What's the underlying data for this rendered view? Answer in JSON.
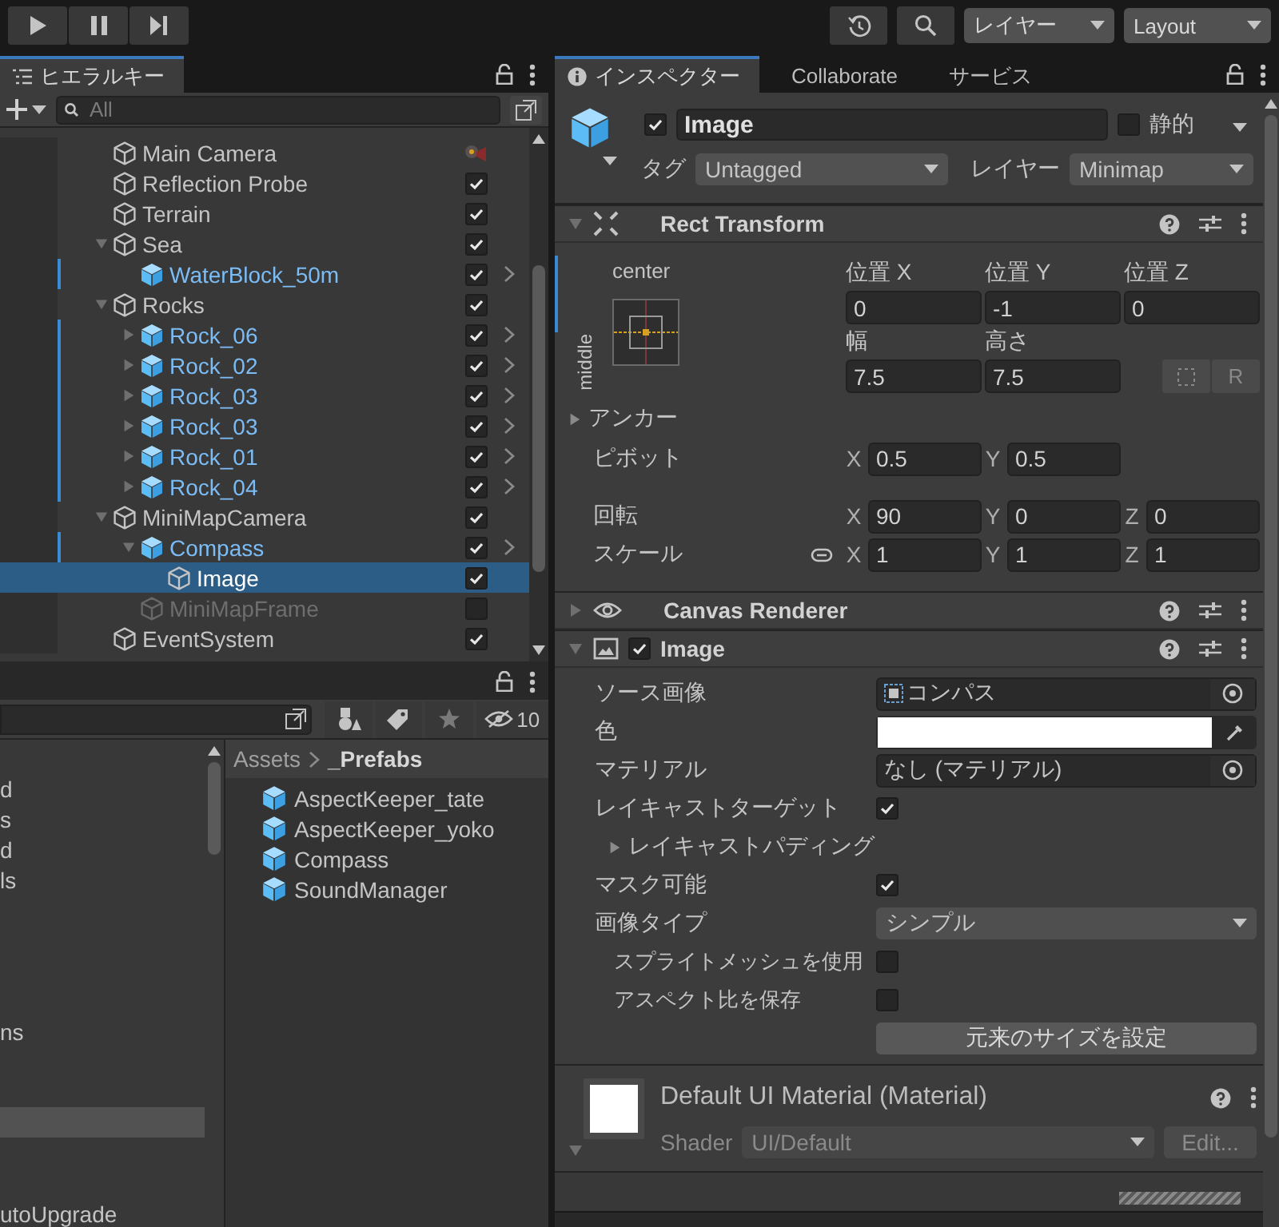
{
  "toolbar": {
    "layers_dropdown": "レイヤー",
    "layout_dropdown": "Layout"
  },
  "hierarchy": {
    "tab": "ヒエラルキー",
    "search": {
      "placeholder": "All"
    },
    "items": [
      {
        "name": "Main Camera",
        "kind": "camera",
        "prefab": false,
        "selected": false
      },
      {
        "name": "Reflection Probe",
        "kind": "object",
        "checked": true,
        "prefab": false,
        "selected": false
      },
      {
        "name": "Terrain",
        "kind": "object",
        "checked": true,
        "prefab": false,
        "selected": false
      },
      {
        "name": "Sea",
        "kind": "object",
        "checked": true,
        "prefab": false,
        "selected": false,
        "expanded": true,
        "children": [
          {
            "name": "WaterBlock_50m",
            "kind": "object",
            "checked": true,
            "prefab": true,
            "selected": false
          }
        ]
      },
      {
        "name": "Rocks",
        "kind": "object",
        "checked": true,
        "prefab": false,
        "selected": false,
        "expanded": true,
        "children": [
          {
            "name": "Rock_06",
            "kind": "object",
            "checked": true,
            "prefab": true,
            "selected": false,
            "expanded": false
          },
          {
            "name": "Rock_02",
            "kind": "object",
            "checked": true,
            "prefab": true,
            "selected": false,
            "expanded": false
          },
          {
            "name": "Rock_03",
            "kind": "object",
            "checked": true,
            "prefab": true,
            "selected": false,
            "expanded": false
          },
          {
            "name": "Rock_03",
            "kind": "object",
            "checked": true,
            "prefab": true,
            "selected": false,
            "expanded": false
          },
          {
            "name": "Rock_01",
            "kind": "object",
            "checked": true,
            "prefab": true,
            "selected": false,
            "expanded": false
          },
          {
            "name": "Rock_04",
            "kind": "object",
            "checked": true,
            "prefab": true,
            "selected": false,
            "expanded": false
          }
        ]
      },
      {
        "name": "MiniMapCamera",
        "kind": "object",
        "checked": true,
        "prefab": false,
        "selected": false,
        "expanded": true,
        "children": [
          {
            "name": "Compass",
            "kind": "object",
            "checked": true,
            "prefab": true,
            "selected": false,
            "expanded": true,
            "children": [
              {
                "name": "Image",
                "kind": "object",
                "checked": true,
                "prefab": false,
                "selected": true
              }
            ]
          },
          {
            "name": "MiniMapFrame",
            "kind": "object",
            "checked": false,
            "prefab": false,
            "selected": false
          }
        ]
      },
      {
        "name": "EventSystem",
        "kind": "object",
        "checked": true,
        "prefab": false,
        "selected": false
      }
    ]
  },
  "project": {
    "hidden_count": "10",
    "folders": [
      {
        "text": "d",
        "selected": false
      },
      {
        "text": "s",
        "selected": false
      },
      {
        "text": "d",
        "selected": false
      },
      {
        "text": "ls",
        "selected": false
      },
      {
        "selected": false
      },
      {
        "selected": false
      },
      {
        "selected": false
      },
      {
        "selected": false
      },
      {
        "text": "ns",
        "selected": false
      },
      {
        "selected": false
      },
      {
        "selected": false
      },
      {
        "selected": true
      },
      {
        "selected": false
      },
      {
        "selected": false
      },
      {
        "text": "utoUpgrade",
        "selected": false
      }
    ],
    "breadcrumb": [
      "Assets",
      "_Prefabs"
    ],
    "assets": [
      "AspectKeeper_tate",
      "AspectKeeper_yoko",
      "Compass",
      "SoundManager"
    ]
  },
  "inspector": {
    "tabs": [
      {
        "label": "インスペクター",
        "selected": true
      },
      {
        "label": "Collaborate",
        "selected": false
      },
      {
        "label": "サービス",
        "selected": false
      }
    ],
    "object": {
      "enabled": true,
      "name": "Image",
      "static_label": "静的",
      "static": false,
      "tag_label": "タグ",
      "tag": "Untagged",
      "layer_label": "レイヤー",
      "layer": "Minimap"
    },
    "components": [
      {
        "kind": "rect_transform",
        "title": "Rect Transform",
        "expanded": true,
        "overridden": true,
        "anchor": {
          "horizontal": "center",
          "vertical": "middle"
        },
        "position": [
          {
            "label": "位置 X",
            "value": "0"
          },
          {
            "label": "位置 Y",
            "value": "-1"
          },
          {
            "label": "位置 Z",
            "value": "0"
          }
        ],
        "size": [
          {
            "label": "幅",
            "value": "7.5"
          },
          {
            "label": "高さ",
            "value": "7.5"
          }
        ],
        "raw_button": "R",
        "anchors": {
          "label": "アンカー",
          "expanded": false
        },
        "pivot": {
          "label": "ピボット",
          "fields": [
            {
              "axis": "X",
              "value": "0.5"
            },
            {
              "axis": "Y",
              "value": "0.5"
            }
          ]
        },
        "rotation": {
          "label": "回転",
          "fields": [
            {
              "axis": "X",
              "value": "90"
            },
            {
              "axis": "Y",
              "value": "0"
            },
            {
              "axis": "Z",
              "value": "0"
            }
          ]
        },
        "scale": {
          "label": "スケール",
          "fields": [
            {
              "axis": "X",
              "value": "1"
            },
            {
              "axis": "Y",
              "value": "1"
            },
            {
              "axis": "Z",
              "value": "1"
            }
          ]
        }
      },
      {
        "kind": "canvas_renderer",
        "title": "Canvas Renderer",
        "expanded": false
      },
      {
        "kind": "image",
        "title": "Image",
        "expanded": true,
        "enabled": true,
        "fields": [
          {
            "kind": "object",
            "label": "ソース画像",
            "value": "コンパス"
          },
          {
            "kind": "color",
            "label": "色",
            "color": "#ffffff"
          },
          {
            "kind": "object",
            "label": "マテリアル",
            "value": "なし (マテリアル)"
          },
          {
            "kind": "checkbox",
            "label": "レイキャストターゲット",
            "checked": true
          },
          {
            "kind": "foldout",
            "label": "レイキャストパディング",
            "expanded": false
          },
          {
            "kind": "checkbox",
            "label": "マスク可能",
            "checked": true
          },
          {
            "kind": "dropdown",
            "label": "画像タイプ",
            "value": "シンプル"
          },
          {
            "kind": "sub_checkbox",
            "label": "スプライトメッシュを使用",
            "checked": false
          },
          {
            "kind": "sub_checkbox",
            "label": "アスペクト比を保存",
            "checked": false
          }
        ],
        "button": "元来のサイズを設定"
      }
    ],
    "material": {
      "name": "Default UI Material (Material)",
      "expanded": true,
      "shader_label": "Shader",
      "shader": "UI/Default",
      "edit_button": "Edit..."
    }
  }
}
